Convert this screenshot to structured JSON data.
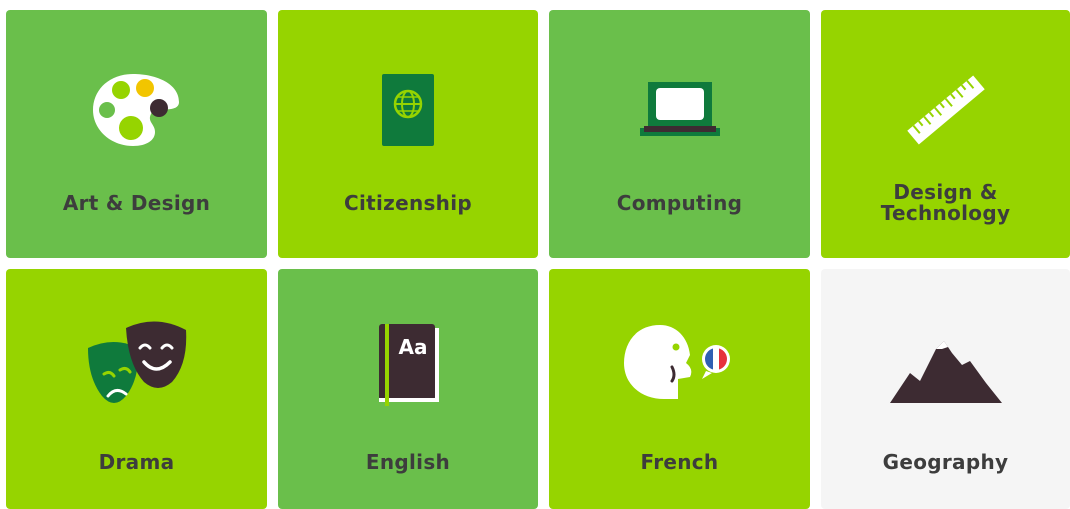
{
  "subjects": [
    {
      "label": "Art & Design",
      "icon": "palette-icon",
      "color": "#6abf4b"
    },
    {
      "label": "Citizenship",
      "icon": "passport-icon",
      "color": "#96d400"
    },
    {
      "label": "Computing",
      "icon": "laptop-icon",
      "color": "#6abf4b"
    },
    {
      "label": "Design &\nTechnology",
      "icon": "ruler-icon",
      "color": "#96d400"
    },
    {
      "label": "Drama",
      "icon": "theatre-masks-icon",
      "color": "#96d400"
    },
    {
      "label": "English",
      "icon": "book-icon",
      "color": "#6abf4b"
    },
    {
      "label": "French",
      "icon": "french-speaker-icon",
      "color": "#96d400"
    },
    {
      "label": "Geography",
      "icon": "mountain-icon",
      "color": "#f5f5f5"
    }
  ],
  "book_text": "Aa"
}
